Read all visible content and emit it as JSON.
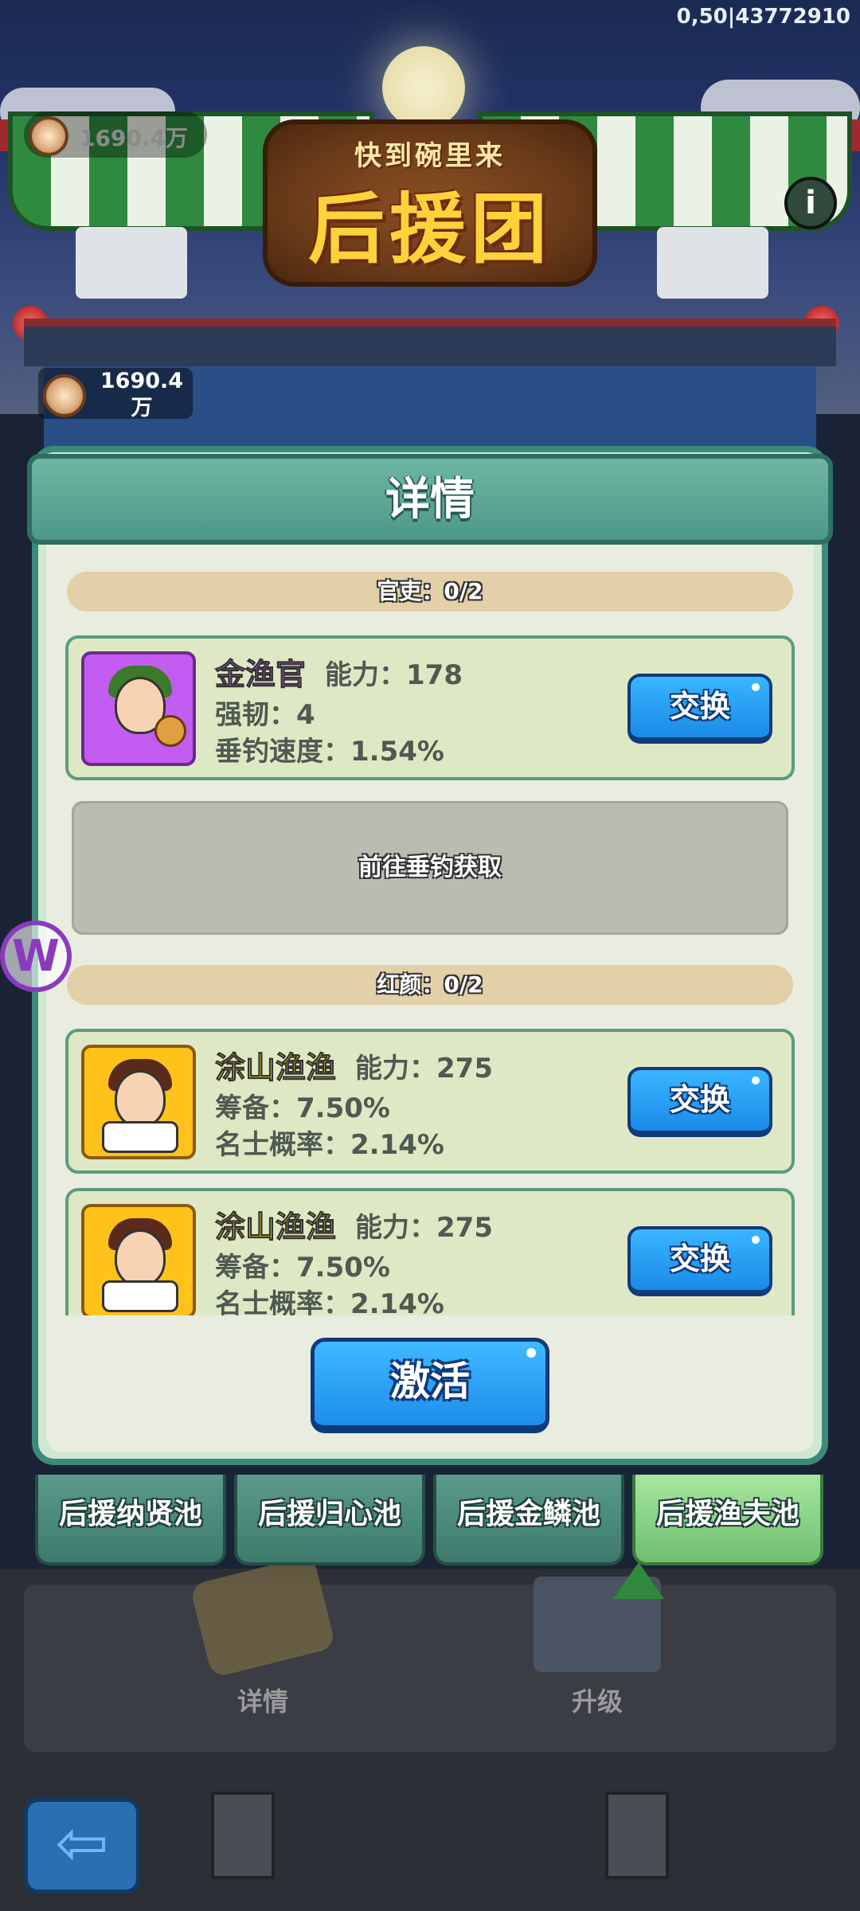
{
  "status_bar": {
    "text": "0,50|43772910"
  },
  "header": {
    "title_small": "快到碗里来",
    "title_main": "后援团",
    "top_coin_value": "1690.4万",
    "info_icon": "info-icon"
  },
  "currency": {
    "value": "1690.4\n万",
    "icon": "coin-icon"
  },
  "dialog": {
    "title": "详情",
    "sections": [
      {
        "label": "官吏：0/2",
        "cards": [
          {
            "name": "金渔官",
            "ability": "能力：178",
            "stat1": "强韧：4",
            "stat2": "垂钓速度：1.54%",
            "button": "交换"
          }
        ],
        "empty_slot": "前往垂钓获取"
      },
      {
        "label": "红颜：0/2",
        "cards": [
          {
            "name": "涂山渔渔",
            "ability": "能力：275",
            "stat1": "筹备：7.50%",
            "stat2": "名士概率：2.14%",
            "button": "交换"
          },
          {
            "name": "涂山渔渔",
            "ability": "能力：275",
            "stat1": "筹备：7.50%",
            "stat2": "名士概率：2.14%",
            "button": "交换"
          }
        ]
      }
    ],
    "activate_label": "激活"
  },
  "tabs": [
    {
      "label": "后援纳贤池",
      "active": false
    },
    {
      "label": "后援归心池",
      "active": false
    },
    {
      "label": "后援金鳞池",
      "active": false
    },
    {
      "label": "后援渔夫池",
      "active": true
    }
  ],
  "scene": {
    "details_label": "详情",
    "upgrade_label": "升级"
  },
  "colors": {
    "accent": "#1d8cec",
    "dialog_border": "#3c8a7a",
    "active_tab": "#6fbf70",
    "name_purple": "#c05af0",
    "name_yellow": "#ffe600"
  }
}
